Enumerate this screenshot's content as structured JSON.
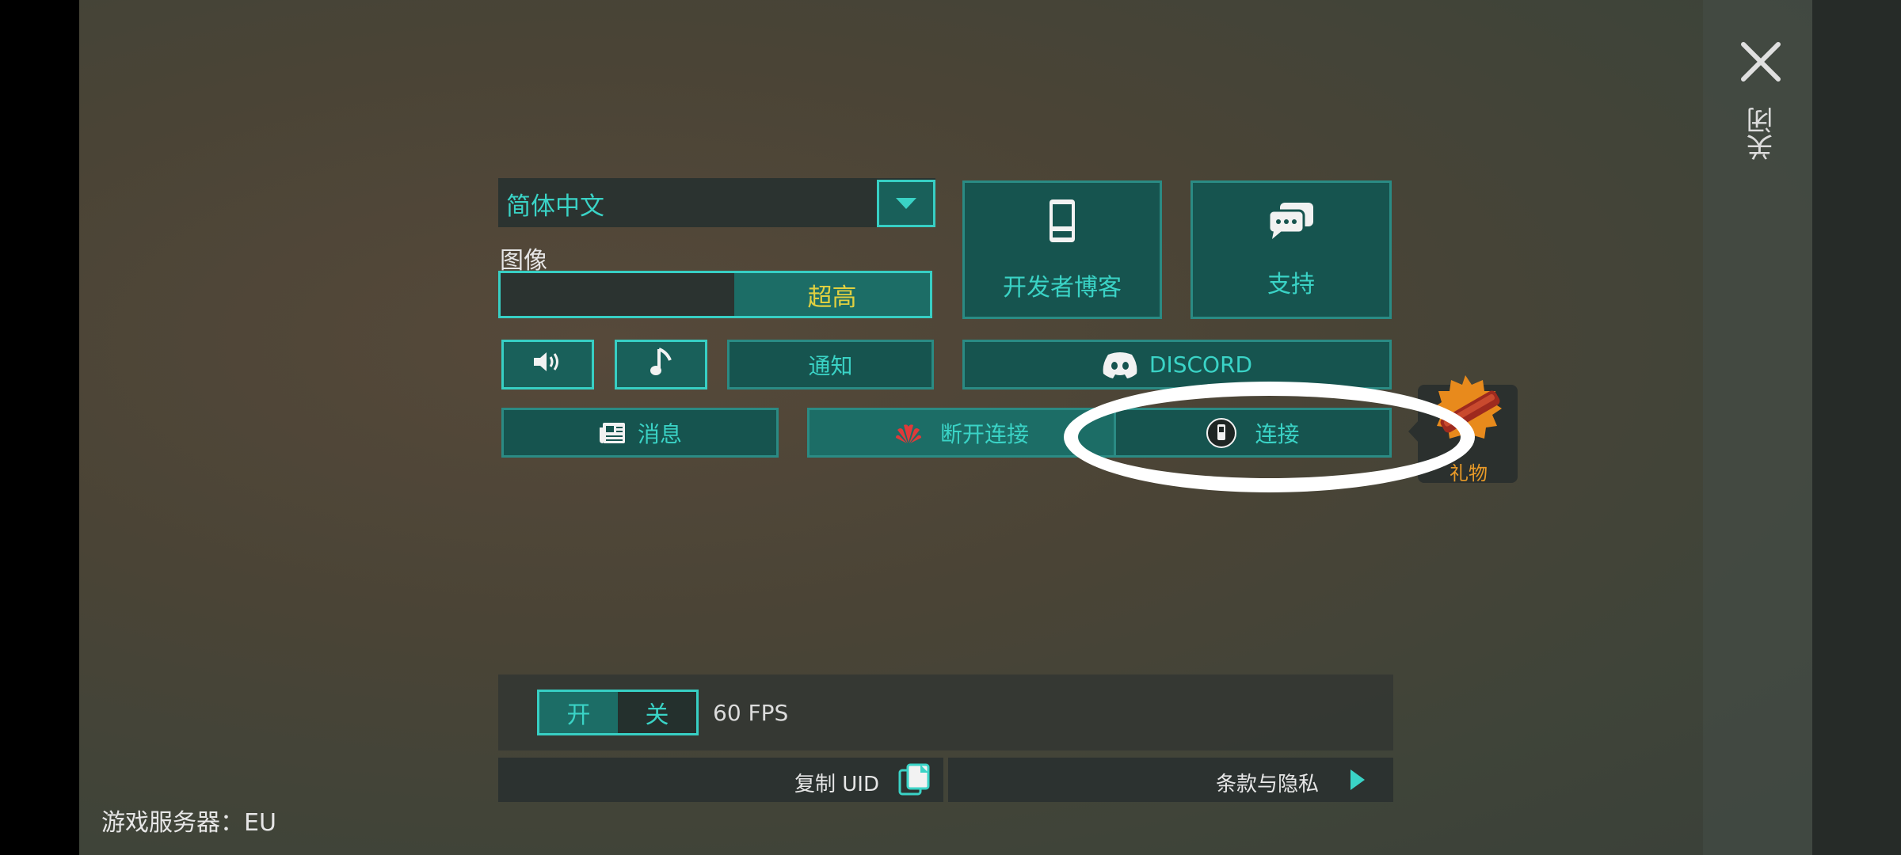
{
  "window": {
    "close_label": "关闭"
  },
  "language": {
    "selected": "简体中文"
  },
  "graphics": {
    "label": "图像",
    "quality": "超高"
  },
  "buttons": {
    "dev_blog": "开发者博客",
    "support": "支持",
    "notifications": "通知",
    "discord": "DISCORD",
    "news": "消息",
    "disconnect": "断开连接",
    "connect": "连接"
  },
  "gift": {
    "label": "礼物"
  },
  "fps": {
    "on_label": "开",
    "off_label": "关",
    "value_text": "60 FPS"
  },
  "footer": {
    "copy_uid": "复制 UID",
    "terms": "条款与隐私",
    "server": "游戏服务器：EU"
  },
  "colors": {
    "accent": "#3ad3c6",
    "button_bg": "#16544f",
    "highlight_yellow": "#e0d040",
    "gift_orange": "#e89a28",
    "huawei_red": "#e03a3a"
  },
  "icons": [
    "close-icon",
    "dropdown-triangle-icon",
    "phone-icon",
    "chat-bubbles-icon",
    "speaker-icon",
    "music-note-icon",
    "discord-icon",
    "newspaper-icon",
    "huawei-icon",
    "gamepad-phone-icon",
    "gift-badge-icon",
    "copy-icon",
    "play-arrow-icon"
  ]
}
